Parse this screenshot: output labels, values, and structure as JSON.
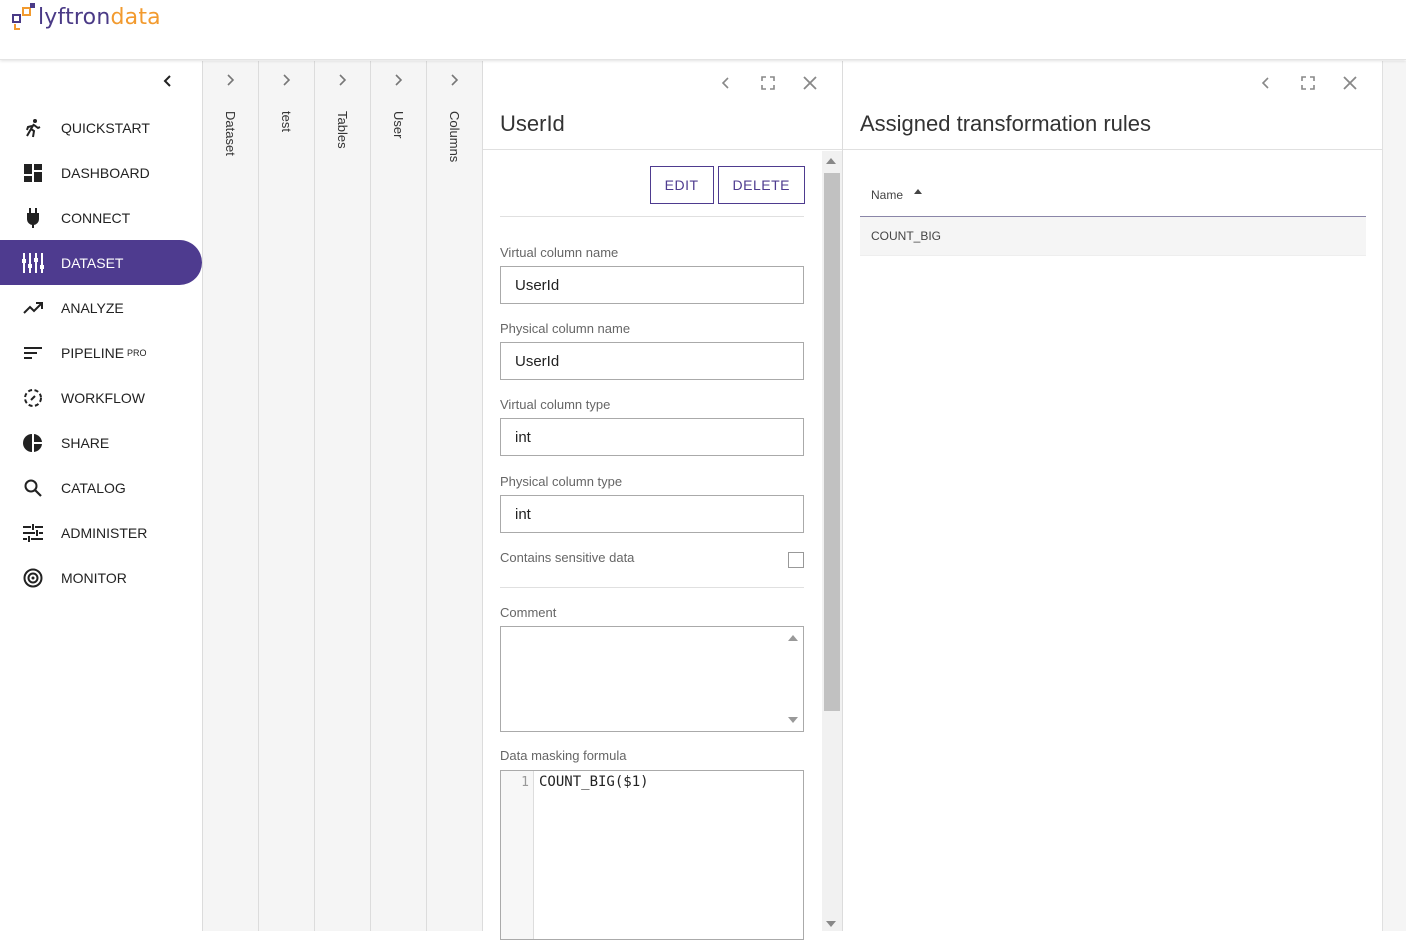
{
  "brand": {
    "name_part1": "lyftron",
    "name_part2": "data",
    "color_primary": "#4a3a86",
    "color_accent": "#f29a2e"
  },
  "sidebar": {
    "collapse_icon": "chevron-left-icon",
    "items": [
      {
        "label": "QUICKSTART",
        "icon": "run-icon",
        "active": false
      },
      {
        "label": "DASHBOARD",
        "icon": "dashboard-icon",
        "active": false
      },
      {
        "label": "CONNECT",
        "icon": "plug-icon",
        "active": false
      },
      {
        "label": "DATASET",
        "icon": "dataset-icon",
        "active": true
      },
      {
        "label": "ANALYZE",
        "icon": "trend-icon",
        "active": false
      },
      {
        "label": "PIPELINE",
        "badge": "PRO",
        "icon": "pipeline-icon",
        "active": false
      },
      {
        "label": "WORKFLOW",
        "icon": "workflow-icon",
        "active": false
      },
      {
        "label": "SHARE",
        "icon": "pie-icon",
        "active": false
      },
      {
        "label": "CATALOG",
        "icon": "search-icon",
        "active": false
      },
      {
        "label": "ADMINISTER",
        "icon": "sliders-icon",
        "active": false
      },
      {
        "label": "MONITOR",
        "icon": "target-icon",
        "active": false
      }
    ],
    "active_color": "#4e3b8f"
  },
  "breadcrumbs": [
    "Dataset",
    "test",
    "Tables",
    "User",
    "Columns"
  ],
  "detail": {
    "title": "UserId",
    "edit_label": "EDIT",
    "delete_label": "DELETE",
    "virtual_name_label": "Virtual column name",
    "virtual_name_value": "UserId",
    "physical_name_label": "Physical column name",
    "physical_name_value": "UserId",
    "virtual_type_label": "Virtual column type",
    "virtual_type_value": "int",
    "physical_type_label": "Physical column type",
    "physical_type_value": "int",
    "sensitive_label": "Contains sensitive data",
    "sensitive_checked": false,
    "comment_label": "Comment",
    "comment_value": "",
    "masking_label": "Data masking formula",
    "masking_line_number": "1",
    "masking_formula": "COUNT_BIG($1)"
  },
  "rules": {
    "title": "Assigned transformation rules",
    "column_name": "Name",
    "sort": "ascending",
    "rows": [
      "COUNT_BIG"
    ]
  }
}
